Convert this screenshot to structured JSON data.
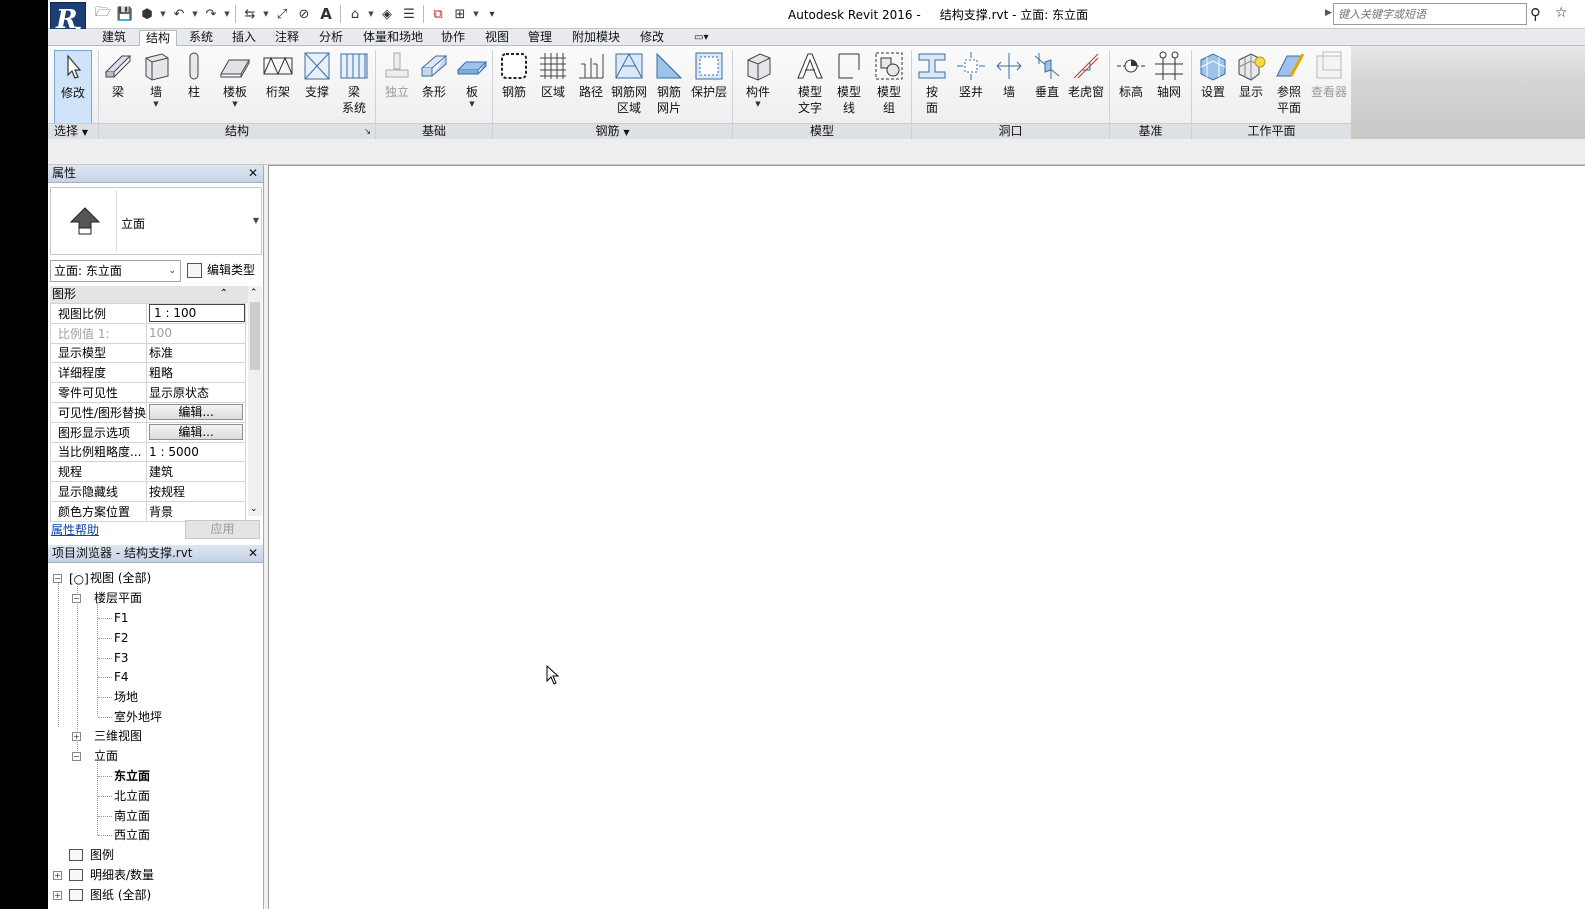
{
  "titlebar": {
    "title": "Autodesk Revit 2016 -     结构支撑.rvt - 立面: 东立面",
    "search_placeholder": "键入关键字或短语"
  },
  "ribbon_tabs": [
    "建筑",
    "结构",
    "系统",
    "插入",
    "注释",
    "分析",
    "体量和场地",
    "协作",
    "视图",
    "管理",
    "附加模块",
    "修改"
  ],
  "active_tab": "结构",
  "ribbon": {
    "select": {
      "modify": "修改",
      "panel": "选择"
    },
    "structure": {
      "beam": "梁",
      "wall": "墙",
      "column": "柱",
      "floor": "楼板",
      "truss": "桁架",
      "brace": "支撑",
      "beam_system_1": "梁",
      "beam_system_2": "系统",
      "panel": "结构"
    },
    "foundation": {
      "isolated": "独立",
      "wall": "条形",
      "slab": "板",
      "panel": "基础"
    },
    "rebar": {
      "rebar": "钢筋",
      "area": "区域",
      "path": "路径",
      "fabric_area_1": "钢筋网",
      "fabric_area_2": "区域",
      "fabric_sheet_1": "钢筋",
      "fabric_sheet_2": "网片",
      "cover": "保护层",
      "panel": "钢筋"
    },
    "model": {
      "component": "构件",
      "text_1": "模型",
      "text_2": "文字",
      "line_1": "模型",
      "line_2": "线",
      "group_1": "模型",
      "group_2": "组",
      "panel": "模型"
    },
    "opening": {
      "by_face_1": "按",
      "by_face_2": "面",
      "shaft": "竖井",
      "wall": "墙",
      "vertical": "垂直",
      "dormer": "老虎窗",
      "panel": "洞口"
    },
    "datum": {
      "level": "标高",
      "grid": "轴网",
      "panel": "基准"
    },
    "work_plane": {
      "set": "设置",
      "show": "显示",
      "ref_1": "参照",
      "ref_2": "平面",
      "viewer": "查看器",
      "panel": "工作平面"
    }
  },
  "properties": {
    "header": "属性",
    "type_name": "立面",
    "instance_selector": "立面: 东立面",
    "edit_type": "编辑类型",
    "group": "图形",
    "rows": [
      {
        "key": "视图比例",
        "value": "1 : 100"
      },
      {
        "key": "比例值 1:",
        "value": "100"
      },
      {
        "key": "显示模型",
        "value": "标准"
      },
      {
        "key": "详细程度",
        "value": "粗略"
      },
      {
        "key": "零件可见性",
        "value": "显示原状态"
      },
      {
        "key": "可见性/图形替换",
        "value": "编辑..."
      },
      {
        "key": "图形显示选项",
        "value": "编辑..."
      },
      {
        "key": "当比例粗略度...",
        "value": "1 : 5000"
      },
      {
        "key": "规程",
        "value": "建筑"
      },
      {
        "key": "显示隐藏线",
        "value": "按规程"
      },
      {
        "key": "颜色方案位置",
        "value": "背景"
      }
    ],
    "help": "属性帮助",
    "apply": "应用"
  },
  "browser": {
    "header": "项目浏览器 - 结构支撑.rvt",
    "views_all": "视图 (全部)",
    "floor_plans": "楼层平面",
    "floor_items": [
      "F1",
      "F2",
      "F3",
      "F4",
      "场地",
      "室外地坪"
    ],
    "views_3d": "三维视图",
    "elevations": "立面",
    "elevation_items": [
      "东立面",
      "北立面",
      "南立面",
      "西立面"
    ],
    "legends": "图例",
    "schedules": "明细表/数量",
    "sheets": "图纸 (全部)"
  }
}
